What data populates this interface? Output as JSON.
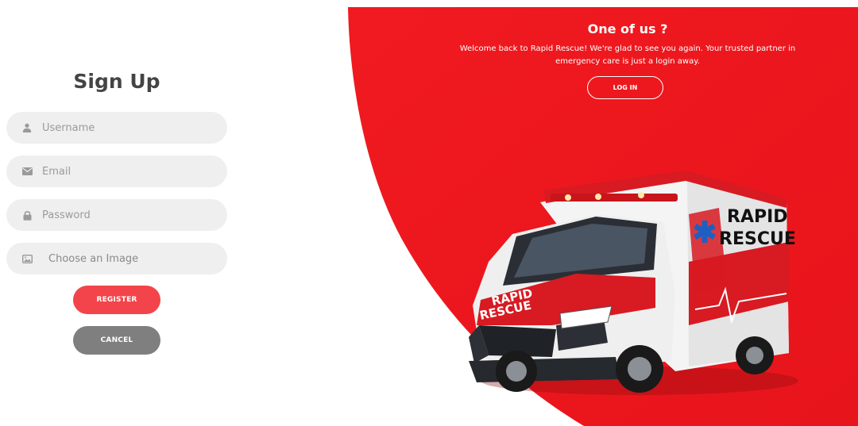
{
  "signup": {
    "title": "Sign Up",
    "username_placeholder": "Username",
    "email_placeholder": "Email",
    "password_placeholder": "Password",
    "image_label": "Choose an Image",
    "register_label": "REGISTER",
    "cancel_label": "CANCEL"
  },
  "panel": {
    "title": "One of us ?",
    "text": "Welcome back to Rapid Rescue! We're glad to see you again. Your trusted partner in emergency care is just a login away.",
    "login_label": "LOG IN",
    "ambulance_text_side_1": "RAPID",
    "ambulance_text_side_2": "RESCUE",
    "ambulance_text_hood_1": "RAPID",
    "ambulance_text_hood_2": "RESCUE"
  },
  "colors": {
    "brand_red": "#ee1c24",
    "register_red": "#f2444a",
    "cancel_gray": "#7f7f7f",
    "field_bg": "#efefef"
  },
  "icons": {
    "username": "user-icon",
    "email": "envelope-icon",
    "password": "lock-icon",
    "image": "image-icon"
  }
}
